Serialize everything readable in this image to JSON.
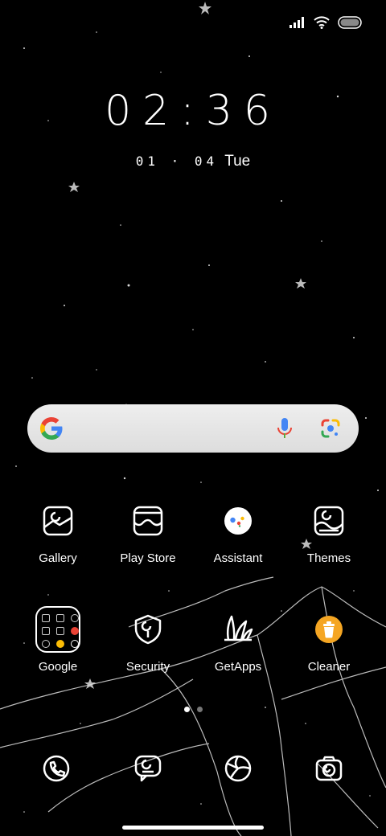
{
  "status": {
    "signal_icon": "cellular-signal-icon",
    "wifi_icon": "wifi-icon",
    "battery_icon": "battery-icon"
  },
  "clock": {
    "time": "02:36",
    "date": "01 · 04",
    "day": "Tue"
  },
  "search": {
    "logo_icon": "google-g-icon",
    "mic_icon": "microphone-icon",
    "lens_icon": "google-lens-icon"
  },
  "apps_row1": [
    {
      "label": "Gallery",
      "icon": "gallery-icon"
    },
    {
      "label": "Play Store",
      "icon": "play-store-icon"
    },
    {
      "label": "Assistant",
      "icon": "assistant-icon"
    },
    {
      "label": "Themes",
      "icon": "themes-icon"
    }
  ],
  "apps_row2": [
    {
      "label": "Google",
      "icon": "folder-icon"
    },
    {
      "label": "Security",
      "icon": "security-icon"
    },
    {
      "label": "GetApps",
      "icon": "getapps-icon"
    },
    {
      "label": "Cleaner",
      "icon": "cleaner-icon"
    }
  ],
  "dock": [
    {
      "icon": "phone-icon"
    },
    {
      "icon": "messages-icon"
    },
    {
      "icon": "browser-icon"
    },
    {
      "icon": "camera-icon"
    }
  ],
  "pages": {
    "count": 2,
    "current": 1
  },
  "colors": {
    "google_blue": "#4285F4",
    "google_red": "#EA4335",
    "google_yellow": "#FBBC05",
    "google_green": "#34A853",
    "cleaner_orange": "#F5A623"
  }
}
